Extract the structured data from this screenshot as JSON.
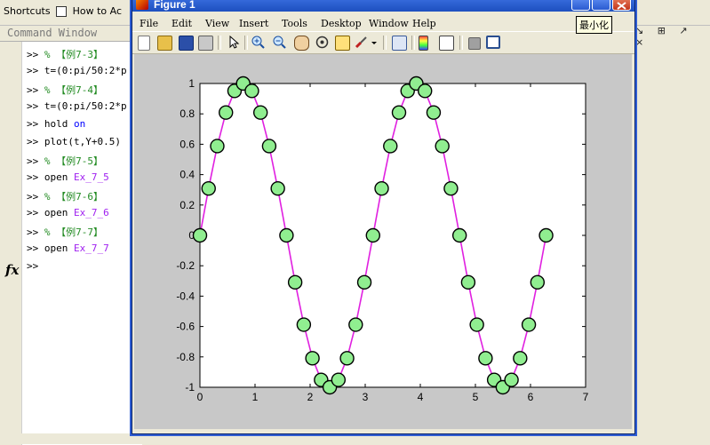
{
  "desktop": {
    "shortcuts_label": "Shortcuts",
    "howto_label": "How to Ac",
    "command_window_title": "Command Window",
    "fx_label": "fx",
    "right_icons": "↘ ⊞ ↗ ×"
  },
  "command_window": {
    "lines": [
      {
        "prompt": ">>",
        "text": "% 【例7-3】",
        "kind": "comment"
      },
      {
        "prompt": ">>",
        "text": "t=(0:pi/50:2*p",
        "kind": "code"
      },
      {
        "prompt": ">>",
        "text": "% 【例7-4】",
        "kind": "comment"
      },
      {
        "prompt": ">>",
        "text": "t=(0:pi/50:2*p",
        "kind": "code"
      },
      {
        "prompt": ">>",
        "text_a": "hold ",
        "text_b": "on",
        "kind": "kw"
      },
      {
        "prompt": ">>",
        "text": "plot(t,Y+0.5)",
        "kind": "code"
      },
      {
        "prompt": ">>",
        "text": "% 【例7-5】",
        "kind": "comment"
      },
      {
        "prompt": ">>",
        "text_a": "open ",
        "text_b": "Ex_7_5",
        "kind": "str"
      },
      {
        "prompt": ">>",
        "text": "% 【例7-6】",
        "kind": "comment"
      },
      {
        "prompt": ">>",
        "text_a": "open ",
        "text_b": "Ex_7_6",
        "kind": "str"
      },
      {
        "prompt": ">>",
        "text": "% 【例7-7】",
        "kind": "comment"
      },
      {
        "prompt": ">>",
        "text_a": "open ",
        "text_b": "Ex_7_7",
        "kind": "str"
      },
      {
        "prompt": ">>",
        "text": "",
        "kind": "code"
      }
    ]
  },
  "figure": {
    "title": "Figure 1",
    "tooltip": "最小化",
    "menu": [
      "File",
      "Edit",
      "View",
      "Insert",
      "Tools",
      "Desktop",
      "Window",
      "Help"
    ]
  },
  "chart_data": {
    "type": "line",
    "xlim": [
      0,
      7
    ],
    "ylim": [
      -1,
      1
    ],
    "xticks": [
      0,
      1,
      2,
      3,
      4,
      5,
      6,
      7
    ],
    "yticks": [
      -1,
      -0.8,
      -0.6,
      -0.4,
      -0.2,
      0,
      0.2,
      0.4,
      0.6,
      0.8,
      1
    ],
    "ytick_labels": [
      "-1",
      "-0.8",
      "-0.6",
      "-0.4",
      "-0.2",
      "0",
      "0.2",
      "0.4",
      "0.6",
      "0.8",
      "1"
    ],
    "line_color": "#e020e0",
    "marker_face": "#90ee90",
    "marker_edge": "#000000",
    "series": [
      {
        "x": [
          0,
          0.1571,
          0.3142,
          0.4712,
          0.6283,
          0.7854,
          0.9425,
          1.0996,
          1.2566,
          1.4137,
          1.5708,
          1.7279,
          1.885,
          2.042,
          2.1991,
          2.3562,
          2.5133,
          2.6704,
          2.8274,
          2.9845,
          3.1416,
          3.2987,
          3.4558,
          3.6128,
          3.7699,
          3.927,
          4.0841,
          4.2412,
          4.3982,
          4.5553,
          4.7124,
          4.8695,
          5.0265,
          5.1836,
          5.3407,
          5.4978,
          5.6549,
          5.8119,
          5.969,
          6.1261,
          6.2832
        ],
        "y": [
          0,
          0.309,
          0.5878,
          0.809,
          0.9511,
          1,
          0.9511,
          0.809,
          0.5878,
          0.309,
          0,
          -0.309,
          -0.5878,
          -0.809,
          -0.9511,
          -1,
          -0.9511,
          -0.809,
          -0.5878,
          -0.309,
          0,
          0.309,
          0.5878,
          0.809,
          0.9511,
          1,
          0.9511,
          0.809,
          0.5878,
          0.309,
          0,
          -0.309,
          -0.5878,
          -0.809,
          -0.9511,
          -1,
          -0.9511,
          -0.809,
          -0.5878,
          -0.309,
          0
        ]
      }
    ]
  }
}
